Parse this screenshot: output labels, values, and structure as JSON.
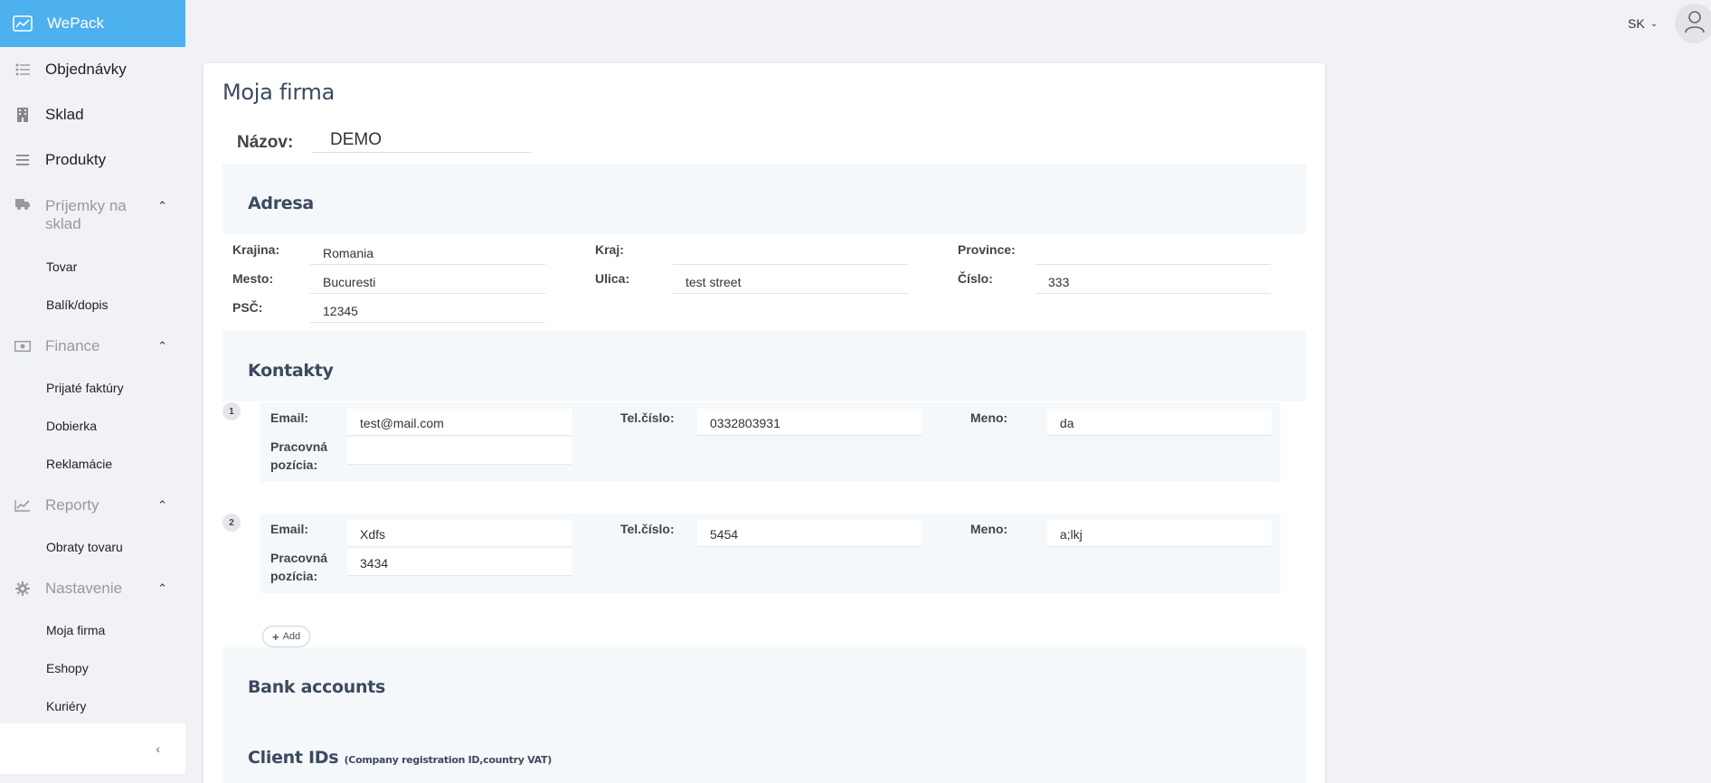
{
  "app": {
    "name": "WePack"
  },
  "sidebar": {
    "items": [
      {
        "label": "Objednávky"
      },
      {
        "label": "Sklad"
      },
      {
        "label": "Produkty"
      },
      {
        "label": "Príjemky na sklad",
        "children": [
          "Tovar",
          "Balík/dopis"
        ]
      },
      {
        "label": "Finance",
        "children": [
          "Prijaté faktúry",
          "Dobierka",
          "Reklamácie"
        ]
      },
      {
        "label": "Reporty",
        "children": [
          "Obraty tovaru"
        ]
      },
      {
        "label": "Nastavenie",
        "children": [
          "Moja firma",
          "Eshopy",
          "Kuriéry"
        ]
      }
    ],
    "group1_line1": "Príjemky na",
    "group1_line2": "sklad"
  },
  "topbar": {
    "language": "SK"
  },
  "page": {
    "title": "Moja firma",
    "name_label": "Názov:",
    "name_value": "DEMO"
  },
  "address": {
    "heading": "Adresa",
    "labels": {
      "country": "Krajina:",
      "region": "Kraj:",
      "province": "Province:",
      "city": "Mesto:",
      "street": "Ulica:",
      "number": "Číslo:",
      "zip": "PSČ:"
    },
    "values": {
      "country": "Romania",
      "region": "",
      "province": "",
      "city": "Bucuresti",
      "street": "test street",
      "number": "333",
      "zip": "12345"
    }
  },
  "contacts": {
    "heading": "Kontakty",
    "labels": {
      "email": "Email:",
      "phone": "Tel.číslo:",
      "name": "Meno:",
      "position_1": "Pracovná",
      "position_2": "pozícia:"
    },
    "items": [
      {
        "num": "1",
        "email": "test@mail.com",
        "phone": "0332803931",
        "name": "da",
        "position": ""
      },
      {
        "num": "2",
        "email": "Xdfs",
        "phone": "5454",
        "name": "a;lkj",
        "position": "3434"
      }
    ],
    "add_label": "Add"
  },
  "bank": {
    "heading": "Bank accounts"
  },
  "client_ids": {
    "heading": "Client IDs",
    "note": "(Company registration ID,country VAT)"
  },
  "colors": {
    "brand": "#4db1f0",
    "heading": "#3c4a5e",
    "section_bg": "#f5f8fb"
  }
}
